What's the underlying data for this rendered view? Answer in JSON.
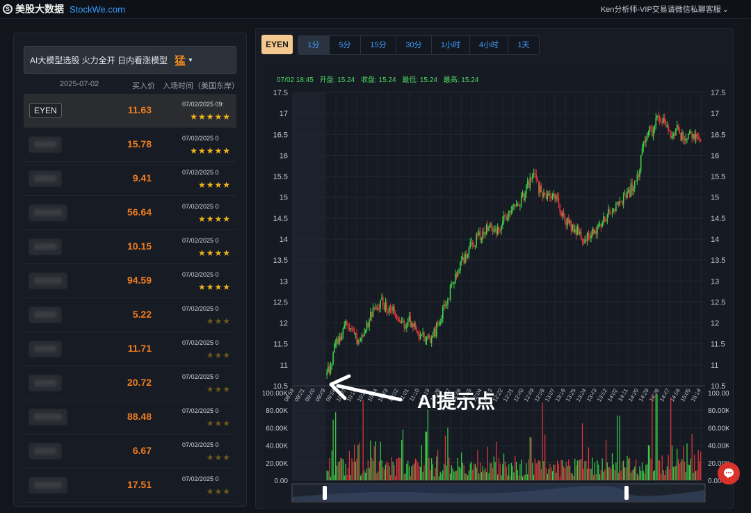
{
  "header": {
    "site_name": "美股大数据",
    "site_url": "StockWe.com",
    "contact": "Ken分析师-VIP交易请微信私聊客服"
  },
  "left": {
    "model_label": "AI大模型选股 火力全开 日内看涨模型",
    "model_strength": "猛",
    "columns": {
      "date": "2025-07-02",
      "price": "买入价",
      "time": "入场时间（美国东岸）"
    },
    "rows": [
      {
        "ticker": "EYEN",
        "price": "11.63",
        "time": "07/02/2025 09:",
        "rating": 5
      },
      {
        "ticker": "XXXX",
        "price": "15.78",
        "time": "07/02/2025 0",
        "rating": 5
      },
      {
        "ticker": "XXXX",
        "price": "9.41",
        "time": "07/02/2025 0",
        "rating": 4
      },
      {
        "ticker": "XXXXX",
        "price": "56.64",
        "time": "07/02/2025 0",
        "rating": 4
      },
      {
        "ticker": "XXXX",
        "price": "10.15",
        "time": "07/02/2025 0",
        "rating": 4
      },
      {
        "ticker": "XXXXX",
        "price": "94.59",
        "time": "07/02/2025 0",
        "rating": 4
      },
      {
        "ticker": "XXXX",
        "price": "5.22",
        "time": "07/02/2025 0",
        "rating": 0
      },
      {
        "ticker": "XXXX",
        "price": "11.71",
        "time": "07/02/2025 0",
        "rating": 0
      },
      {
        "ticker": "XXXX",
        "price": "20.72",
        "time": "07/02/2025 0",
        "rating": 0
      },
      {
        "ticker": "XXXXX",
        "price": "88.48",
        "time": "07/02/2025 0",
        "rating": 0
      },
      {
        "ticker": "XXXX",
        "price": "6.67",
        "time": "07/02/2025 0",
        "rating": 0
      },
      {
        "ticker": "XXXXX",
        "price": "17.51",
        "time": "07/02/2025 0",
        "rating": 0
      }
    ]
  },
  "chart": {
    "symbol": "EYEN",
    "timeframes": [
      "1分",
      "5分",
      "15分",
      "30分",
      "1小时",
      "4小时",
      "1天"
    ],
    "selected_timeframe": "1分",
    "info": {
      "datetime": "07/02 18:45",
      "open": "开盘: 15.24",
      "close": "收盘: 15.24",
      "low": "最低: 15.24",
      "high": "最高: 15.24"
    },
    "annotation": "AI提示点"
  },
  "colors": {
    "up": "#3fd14a",
    "down": "#e8383d",
    "accent": "#f07d1f",
    "star": "#f0b51a",
    "link": "#3f9fff"
  },
  "chart_data": {
    "type": "candlestick",
    "title": "",
    "price_axis": {
      "ticks": [
        "10.5",
        "11",
        "11.5",
        "12",
        "12.5",
        "13",
        "13.5",
        "14",
        "14.5",
        "15",
        "15.5",
        "16",
        "16.5",
        "17",
        "17.5"
      ],
      "ylim": [
        10.5,
        17.5
      ]
    },
    "volume_axis": {
      "ticks": [
        "0.00",
        "20.00K",
        "40.00K",
        "60.00K",
        "80.00K",
        "100.00K"
      ],
      "ylim": [
        0,
        100000
      ]
    },
    "time_ticks": [
      "08:59",
      "09:31",
      "09:40",
      "09:49",
      "09:58",
      "10:07",
      "10:16",
      "10:25",
      "10:34",
      "10:43",
      "10:52",
      "11:01",
      "11:10",
      "11:19",
      "11:28",
      "11:37",
      "11:46",
      "11:55",
      "12:04",
      "12:13",
      "12:22",
      "12:31",
      "12:40",
      "12:49",
      "12:58",
      "13:07",
      "13:16",
      "13:25",
      "13:34",
      "13:43",
      "13:52",
      "14:02",
      "14:11",
      "14:20",
      "14:29",
      "14:38",
      "14:47",
      "14:56",
      "15:05",
      "15:14"
    ],
    "price_path": [
      [
        "09:31",
        10.75
      ],
      [
        "09:35",
        11.0
      ],
      [
        "09:38",
        11.6
      ],
      [
        "09:42",
        11.55
      ],
      [
        "09:45",
        11.9
      ],
      [
        "09:49",
        12.1
      ],
      [
        "09:54",
        11.75
      ],
      [
        "10:00",
        11.55
      ],
      [
        "10:05",
        11.7
      ],
      [
        "10:12",
        12.2
      ],
      [
        "10:20",
        12.5
      ],
      [
        "10:26",
        12.35
      ],
      [
        "10:34",
        12.3
      ],
      [
        "10:40",
        12.0
      ],
      [
        "10:47",
        12.05
      ],
      [
        "10:52",
        11.9
      ],
      [
        "10:58",
        11.65
      ],
      [
        "11:04",
        11.6
      ],
      [
        "11:10",
        11.75
      ],
      [
        "11:16",
        12.2
      ],
      [
        "11:22",
        12.6
      ],
      [
        "11:28",
        13.1
      ],
      [
        "11:36",
        13.5
      ],
      [
        "11:44",
        13.9
      ],
      [
        "11:52",
        14.1
      ],
      [
        "11:58",
        14.3
      ],
      [
        "12:05",
        14.15
      ],
      [
        "12:12",
        14.4
      ],
      [
        "12:20",
        14.7
      ],
      [
        "12:28",
        14.85
      ],
      [
        "12:34",
        15.2
      ],
      [
        "12:40",
        15.6
      ],
      [
        "12:44",
        15.3
      ],
      [
        "12:50",
        15.0
      ],
      [
        "12:56",
        15.0
      ],
      [
        "13:02",
        14.9
      ],
      [
        "13:08",
        14.5
      ],
      [
        "13:14",
        14.3
      ],
      [
        "13:20",
        14.2
      ],
      [
        "13:26",
        13.9
      ],
      [
        "13:32",
        14.1
      ],
      [
        "13:38",
        14.15
      ],
      [
        "13:45",
        14.5
      ],
      [
        "13:52",
        14.7
      ],
      [
        "14:00",
        14.9
      ],
      [
        "14:08",
        15.1
      ],
      [
        "14:14",
        15.4
      ],
      [
        "14:18",
        15.7
      ],
      [
        "14:22",
        16.3
      ],
      [
        "14:26",
        16.6
      ],
      [
        "14:30",
        16.5
      ],
      [
        "14:33",
        17.0
      ],
      [
        "14:36",
        16.7
      ],
      [
        "14:40",
        16.9
      ],
      [
        "14:44",
        16.5
      ],
      [
        "14:48",
        16.35
      ],
      [
        "14:52",
        16.6
      ],
      [
        "14:58",
        16.4
      ],
      [
        "15:05",
        16.55
      ],
      [
        "15:10",
        16.4
      ],
      [
        "15:14",
        16.2
      ]
    ],
    "grid": true
  }
}
